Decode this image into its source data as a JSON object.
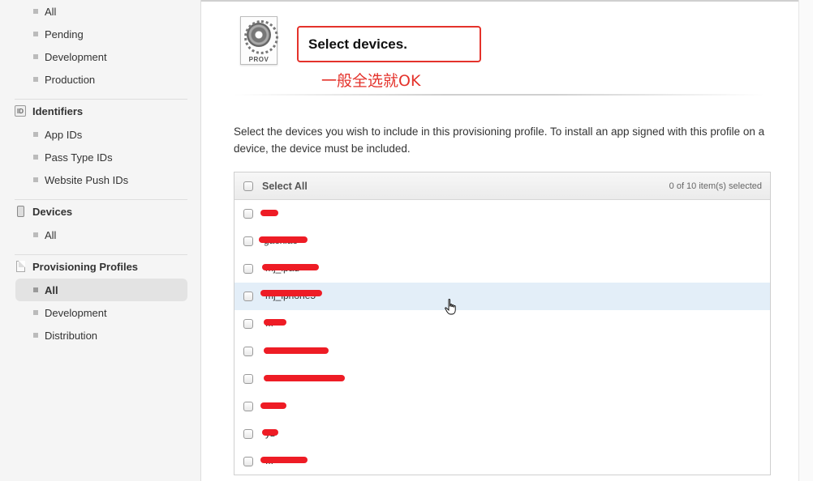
{
  "sidebar": {
    "certificates": [
      "All",
      "Pending",
      "Development",
      "Production"
    ],
    "identifiers": {
      "title": "Identifiers",
      "icon": "id-badge-icon",
      "items": [
        "App IDs",
        "Pass Type IDs",
        "Website Push IDs"
      ]
    },
    "devices": {
      "title": "Devices",
      "icon": "iphone-icon",
      "items": [
        "All"
      ]
    },
    "profiles": {
      "title": "Provisioning Profiles",
      "icon": "document-icon",
      "items": [
        "All",
        "Development",
        "Distribution"
      ],
      "active": "All"
    }
  },
  "header": {
    "icon_label": "PROV",
    "title": "Select devices.",
    "annotation": "一般全选就OK",
    "annotation_color": "#e4322b"
  },
  "description": "Select the devices you wish to include in this provisioning profile. To install an app signed with this profile on a device, the device must be included.",
  "device_list": {
    "select_all_label": "Select All",
    "count_label": "0 of 10 item(s) selected",
    "rows": [
      {
        "name": "..."
      },
      {
        "name": "gaoxiao"
      },
      {
        "name": "mj_ipad"
      },
      {
        "name": "mj_iphone5"
      },
      {
        "name": "..."
      },
      {
        "name": "..."
      },
      {
        "name": "..."
      },
      {
        "name": "..."
      },
      {
        "name": "yz"
      },
      {
        "name": "..."
      }
    ]
  }
}
